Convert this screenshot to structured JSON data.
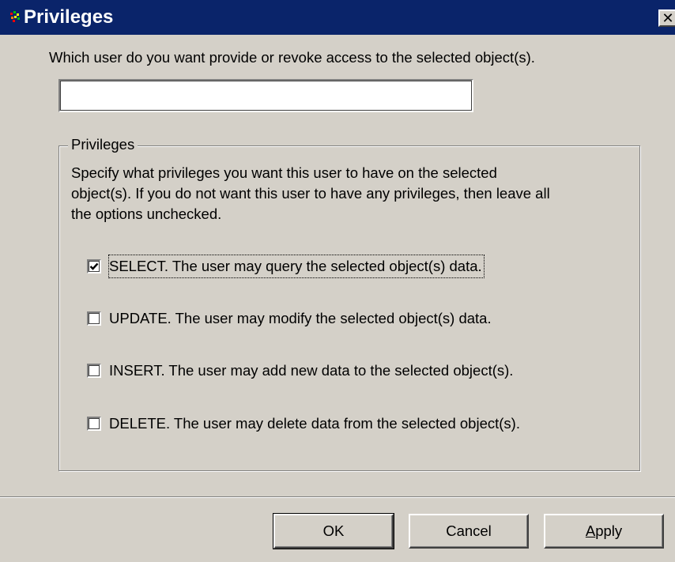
{
  "window": {
    "title": "Privileges",
    "close_glyph": "✕"
  },
  "prompt": {
    "text": "Which user do you want provide or revoke access to the selected object(s).",
    "user_input_value": "",
    "user_input_placeholder": ""
  },
  "privileges_group": {
    "legend": "Privileges",
    "description_lines": [
      "Specify what privileges you want this user to have on the selected",
      "object(s). If you do not want this user to have any privileges, then leave all",
      "the options unchecked."
    ],
    "options": [
      {
        "label": "SELECT. The user may query the selected object(s) data.",
        "checked": true
      },
      {
        "label": "UPDATE. The user may modify the selected object(s) data.",
        "checked": false
      },
      {
        "label": "INSERT. The user may add new data to the selected object(s).",
        "checked": false
      },
      {
        "label": "DELETE. The user may delete data from the selected object(s).",
        "checked": false
      }
    ]
  },
  "buttons": {
    "ok": "OK",
    "cancel": "Cancel",
    "apply": "Apply"
  },
  "colors": {
    "titlebar": "#0a246a",
    "dialog_face": "#d4d0c8"
  }
}
